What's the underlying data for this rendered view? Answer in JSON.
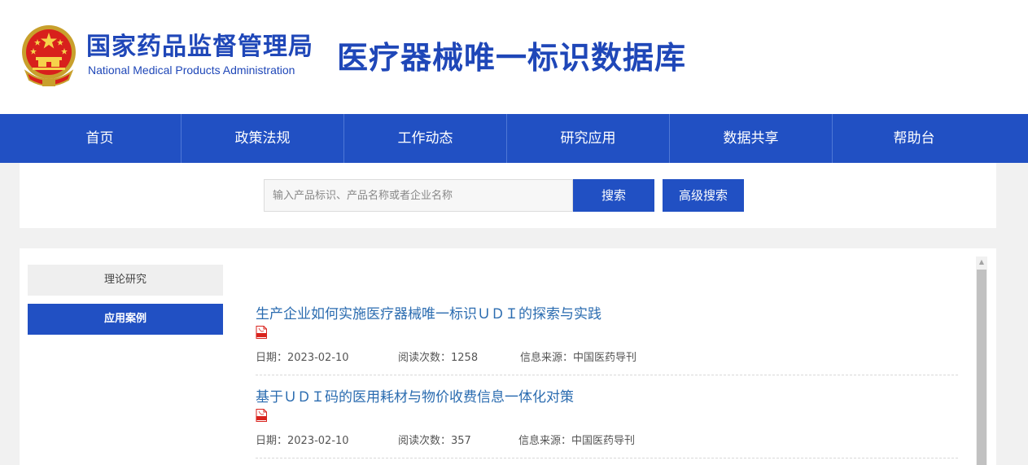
{
  "header": {
    "org_cn": "国家药品监督管理局",
    "org_en": "National Medical Products  Administration",
    "site_title": "医疗器械唯一标识数据库"
  },
  "nav": [
    {
      "label": "首页"
    },
    {
      "label": "政策法规"
    },
    {
      "label": "工作动态"
    },
    {
      "label": "研究应用"
    },
    {
      "label": "数据共享"
    },
    {
      "label": "帮助台"
    }
  ],
  "search": {
    "placeholder": "输入产品标识、产品名称或者企业名称",
    "search_label": "搜索",
    "advanced_label": "高级搜索"
  },
  "sidebar": {
    "items": [
      {
        "label": "理论研究",
        "active": false
      },
      {
        "label": "应用案例",
        "active": true
      }
    ]
  },
  "articles": [
    {
      "title": "生产企业如何实施医疗器械唯一标识ＵＤＩ的探索与实践",
      "date": "日期：2023-02-10",
      "reads": "阅读次数：1258",
      "source": "信息来源：中国医药导刊"
    },
    {
      "title": "基于ＵＤＩ码的医用耗材与物价收费信息一体化对策",
      "date": "日期：2023-02-10",
      "reads": "阅读次数：357",
      "source": "信息来源：中国医药导刊"
    }
  ],
  "colors": {
    "brand_blue": "#2150c3",
    "title_blue": "#1f47b8",
    "link_blue": "#2b6cb0",
    "pdf_red": "#d9231d"
  },
  "icons": {
    "emblem": "national-emblem-icon",
    "pdf": "pdf-icon",
    "scroll_up": "scroll-up-arrow-icon"
  }
}
